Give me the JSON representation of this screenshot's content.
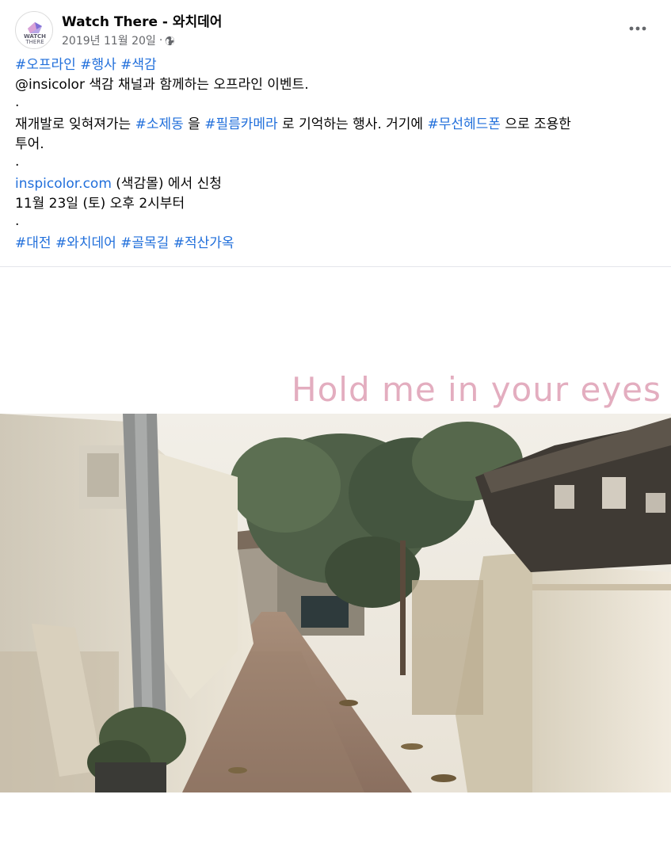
{
  "post": {
    "page_name": "Watch There - 와치데어",
    "date": "2019년 11월 20일",
    "separator": "·",
    "avatar_text_top": "WATCH",
    "avatar_text_bottom": "THERE",
    "icons": {
      "privacy": "globe-icon",
      "menu": "more-icon"
    }
  },
  "body": {
    "hashtags_top": [
      "#오프라인",
      "#행사",
      "#색감"
    ],
    "line2": "@insicolor 색감 채널과 함께하는 오프라인 이벤트.",
    "dot": ".",
    "line4": {
      "t1": "재개발로 잊혀져가는 ",
      "tag1": "#소제동",
      "t2": " 을 ",
      "tag2": "#필름카메라",
      "t3": " 로 기억하는 행사. 거기에 ",
      "tag3": "#무선헤드폰",
      "t4": " 으로 조용한"
    },
    "line5": "투어.",
    "line7": {
      "link": "inspicolor.com",
      "rest": " (색감몰) 에서 신청"
    },
    "line8": "11월 23일 (토) 오후 2시부터",
    "hashtags_bottom": [
      "#대전",
      "#와치데어",
      "#골목길",
      "#적산가옥"
    ]
  },
  "photo": {
    "caption": "Hold me in your eyes"
  },
  "colors": {
    "link": "#216fdb",
    "secondary_text": "#65676b",
    "caption_pink": "#e3adbf"
  }
}
